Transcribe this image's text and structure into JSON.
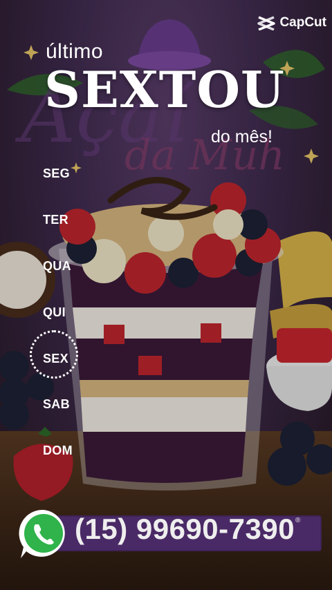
{
  "watermark": {
    "label": "CapCut",
    "icon": "capcut-logo-icon"
  },
  "brand": {
    "logo_text": "Açaí da Muh"
  },
  "headline": {
    "top": "último",
    "main": "SEXTOU",
    "bottom": "do mês!"
  },
  "days": [
    {
      "label": "SEG",
      "selected": false
    },
    {
      "label": "TER",
      "selected": false
    },
    {
      "label": "QUA",
      "selected": false
    },
    {
      "label": "QUI",
      "selected": false
    },
    {
      "label": "SEX",
      "selected": true
    },
    {
      "label": "SAB",
      "selected": false
    },
    {
      "label": "DOM",
      "selected": false
    }
  ],
  "contact": {
    "icon": "whatsapp-icon",
    "phone": "(15) 99690-7390",
    "registered_mark": "®"
  },
  "colors": {
    "purple": "#4a2a66",
    "acai": "#3c1a3a",
    "strawberry": "#c0262e",
    "text": "#ffffff"
  }
}
